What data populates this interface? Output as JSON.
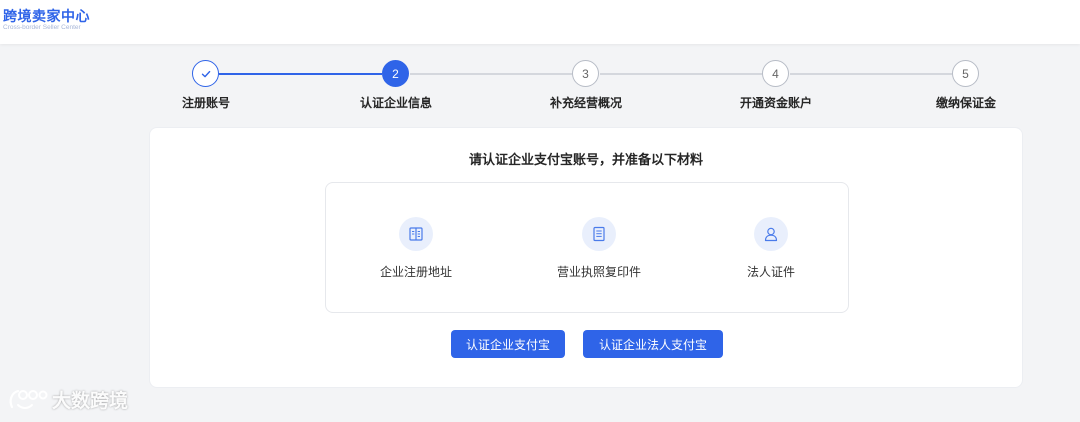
{
  "header": {
    "title": "跨境卖家中心",
    "subtitle": "Cross-border Seller Center"
  },
  "steps": [
    {
      "number": "✓",
      "label": "注册账号",
      "state": "done"
    },
    {
      "number": "2",
      "label": "认证企业信息",
      "state": "active"
    },
    {
      "number": "3",
      "label": "补充经营概况",
      "state": "pending"
    },
    {
      "number": "4",
      "label": "开通资金账户",
      "state": "pending"
    },
    {
      "number": "5",
      "label": "缴纳保证金",
      "state": "pending"
    }
  ],
  "card": {
    "title": "请认证企业支付宝账号，并准备以下材料",
    "materials": [
      {
        "icon": "building-icon",
        "label": "企业注册地址"
      },
      {
        "icon": "document-icon",
        "label": "营业执照复印件"
      },
      {
        "icon": "user-icon",
        "label": "法人证件"
      }
    ],
    "buttons": {
      "company_alipay": "认证企业支付宝",
      "legal_person_alipay": "认证企业法人支付宝"
    }
  },
  "watermark": "大数跨境",
  "colors": {
    "accent": "#2f64e8",
    "page_bg": "#f3f4f6",
    "icon_bg": "#e9effc"
  }
}
